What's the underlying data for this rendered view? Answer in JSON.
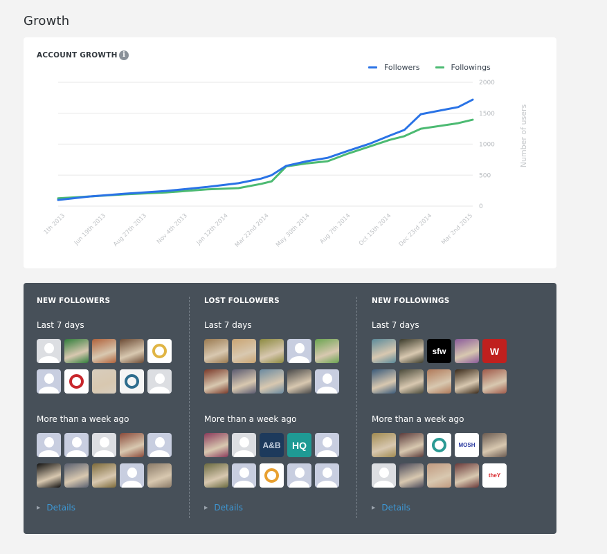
{
  "page": {
    "title": "Growth"
  },
  "chart_card": {
    "title": "ACCOUNT GROWTH",
    "info_icon": "info-icon"
  },
  "chart_data": {
    "type": "line",
    "title": "ACCOUNT GROWTH",
    "xlabel": "",
    "ylabel": "Number of users",
    "ylim": [
      0,
      2000
    ],
    "yticks": [
      0,
      500,
      1000,
      1500,
      2000
    ],
    "grid": true,
    "legend_position": "top-right",
    "x_tick_labels": [
      "...1th 2013",
      "Jun 19th 2013",
      "Aug 27th 2013",
      "Nov 4th 2013",
      "Jan 12th 2014",
      "Mar 22nd 2014",
      "May 30th 2014",
      "Aug 7th 2014",
      "Oct 15th 2014",
      "Dec 23rd 2014",
      "Mar 2nd 2015"
    ],
    "x": [
      0,
      0.075,
      0.16,
      0.26,
      0.36,
      0.435,
      0.49,
      0.515,
      0.55,
      0.6,
      0.65,
      0.7,
      0.75,
      0.8,
      0.835,
      0.875,
      0.965,
      1.0
    ],
    "series": [
      {
        "name": "Followers",
        "color": "#2a73e6",
        "values": [
          100,
          155,
          200,
          245,
          310,
          370,
          445,
          500,
          650,
          725,
          780,
          895,
          1005,
          1140,
          1230,
          1485,
          1600,
          1720
        ]
      },
      {
        "name": "Followings",
        "color": "#4cba72",
        "values": [
          125,
          155,
          190,
          220,
          270,
          290,
          360,
          400,
          640,
          690,
          725,
          850,
          960,
          1070,
          1130,
          1250,
          1340,
          1395
        ]
      }
    ]
  },
  "panels": [
    {
      "title": "NEW FOLLOWERS",
      "recent_label": "Last 7 days",
      "older_label": "More than a week ago",
      "details_label": "Details",
      "recent": [
        {
          "kind": "placeholder",
          "bg": "#dcdee2"
        },
        {
          "kind": "image",
          "bg": "#2f7d3a",
          "fg": "#ffffff",
          "text": ""
        },
        {
          "kind": "image",
          "bg": "#b0613a",
          "text": ""
        },
        {
          "kind": "image",
          "bg": "#6b4a34",
          "text": ""
        },
        {
          "kind": "image",
          "bg": "#ffffff",
          "ring": "#e0b545",
          "text": ""
        },
        {
          "kind": "placeholder",
          "bg": "#c8cee0"
        },
        {
          "kind": "image",
          "bg": "#ffffff",
          "ring": "#c8262c",
          "text": ""
        },
        {
          "kind": "image",
          "bg": "#d8cdbd",
          "text": ""
        },
        {
          "kind": "image",
          "bg": "#f5f5f5",
          "ring": "#2e6d8e",
          "text": ""
        },
        {
          "kind": "placeholder",
          "bg": "#dcdee2"
        }
      ],
      "older": [
        {
          "kind": "placeholder",
          "bg": "#c8cee0"
        },
        {
          "kind": "placeholder",
          "bg": "#c8cee0"
        },
        {
          "kind": "placeholder",
          "bg": "#dcdee2"
        },
        {
          "kind": "image",
          "bg": "#8a4a3a",
          "text": ""
        },
        {
          "kind": "placeholder",
          "bg": "#c8cee0"
        },
        {
          "kind": "image",
          "bg": "#111111",
          "text": ""
        },
        {
          "kind": "image",
          "bg": "#5a6070",
          "text": ""
        },
        {
          "kind": "image",
          "bg": "#7c6a3a",
          "text": ""
        },
        {
          "kind": "placeholder",
          "bg": "#c8cee0"
        },
        {
          "kind": "image",
          "bg": "#8a7a68",
          "text": ""
        }
      ]
    },
    {
      "title": "LOST FOLLOWERS",
      "recent_label": "Last 7 days",
      "older_label": "More than a week ago",
      "details_label": "Details",
      "recent": [
        {
          "kind": "image",
          "bg": "#9a7a50",
          "text": ""
        },
        {
          "kind": "image",
          "bg": "#c9a472",
          "text": ""
        },
        {
          "kind": "image",
          "bg": "#8c8a40",
          "text": ""
        },
        {
          "kind": "placeholder",
          "bg": "#c8cee0"
        },
        {
          "kind": "image",
          "bg": "#6aa450",
          "text": ""
        },
        {
          "kind": "image",
          "bg": "#7a3a2a",
          "text": ""
        },
        {
          "kind": "image",
          "bg": "#5a5a70",
          "text": ""
        },
        {
          "kind": "image",
          "bg": "#6a8aa0",
          "text": ""
        },
        {
          "kind": "image",
          "bg": "#4a4a4a",
          "text": ""
        },
        {
          "kind": "placeholder",
          "bg": "#c8cee0"
        }
      ],
      "older": [
        {
          "kind": "image",
          "bg": "#8a3a5a",
          "text": ""
        },
        {
          "kind": "placeholder",
          "bg": "#dcdee2"
        },
        {
          "kind": "image",
          "bg": "#1d3a5c",
          "fg": "#c8d2e0",
          "text": "A&B"
        },
        {
          "kind": "image",
          "bg": "#1f9a94",
          "fg": "#ffffff",
          "text": "HQ"
        },
        {
          "kind": "placeholder",
          "bg": "#c8cee0"
        },
        {
          "kind": "image",
          "bg": "#6a6a40",
          "text": ""
        },
        {
          "kind": "placeholder",
          "bg": "#c8cee0"
        },
        {
          "kind": "image",
          "bg": "#ffffff",
          "ring": "#e8a030",
          "text": ""
        },
        {
          "kind": "placeholder",
          "bg": "#c8cee0"
        },
        {
          "kind": "placeholder",
          "bg": "#c8cee0"
        }
      ]
    },
    {
      "title": "NEW FOLLOWINGS",
      "recent_label": "Last 7 days",
      "older_label": "More than a week ago",
      "details_label": "Details",
      "recent": [
        {
          "kind": "image",
          "bg": "#5a8a9a",
          "text": ""
        },
        {
          "kind": "image",
          "bg": "#3a3a2a",
          "text": ""
        },
        {
          "kind": "image",
          "bg": "#000000",
          "fg": "#ffffff",
          "text": "sfw"
        },
        {
          "kind": "image",
          "bg": "#8a5a9a",
          "text": ""
        },
        {
          "kind": "image",
          "bg": "#c0201e",
          "fg": "#ffffff",
          "text": "W"
        },
        {
          "kind": "image",
          "bg": "#3a5a7a",
          "text": ""
        },
        {
          "kind": "image",
          "bg": "#4a4a3a",
          "text": ""
        },
        {
          "kind": "image",
          "bg": "#b07a5a",
          "text": ""
        },
        {
          "kind": "image",
          "bg": "#3a2a1a",
          "text": ""
        },
        {
          "kind": "image",
          "bg": "#a05a4a",
          "text": ""
        }
      ],
      "older": [
        {
          "kind": "image",
          "bg": "#a08a50",
          "text": ""
        },
        {
          "kind": "image",
          "bg": "#5a3a3a",
          "text": ""
        },
        {
          "kind": "image",
          "bg": "#ffffff",
          "ring": "#2a9a94",
          "text": ""
        },
        {
          "kind": "image",
          "bg": "#ffffff",
          "fg": "#2a3aa0",
          "text": "MOSH"
        },
        {
          "kind": "image",
          "bg": "#6a5a50",
          "text": ""
        },
        {
          "kind": "placeholder",
          "bg": "#dcdee2"
        },
        {
          "kind": "image",
          "bg": "#4a4a5a",
          "text": ""
        },
        {
          "kind": "image",
          "bg": "#c09a80",
          "text": ""
        },
        {
          "kind": "image",
          "bg": "#6a3a3a",
          "text": ""
        },
        {
          "kind": "image",
          "bg": "#ffffff",
          "fg": "#d8262a",
          "text": "theY"
        }
      ]
    }
  ]
}
